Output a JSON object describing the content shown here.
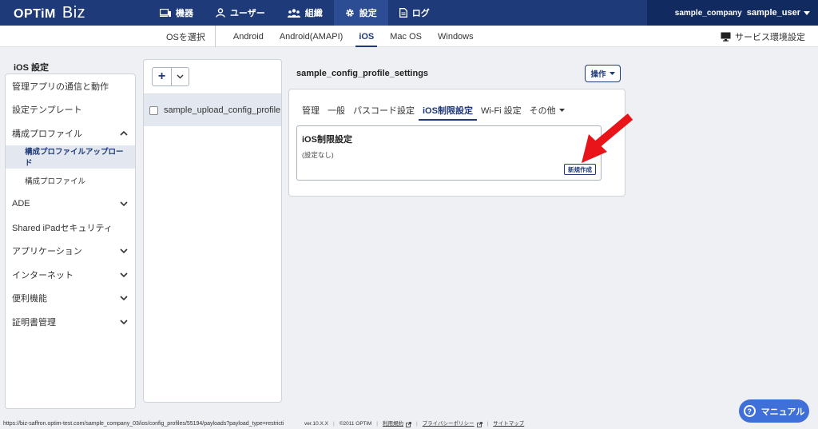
{
  "app": {
    "logo_brand": "OPTiM",
    "logo_product": "Biz"
  },
  "mainnav": {
    "devices": "機器",
    "users": "ユーザー",
    "org": "組織",
    "settings": "設定",
    "logs": "ログ"
  },
  "user": {
    "company": "sample_company",
    "name": "sample_user"
  },
  "subnav": {
    "os_select": "OSを選択",
    "tabs": [
      "Android",
      "Android(AMAPI)",
      "iOS",
      "Mac OS",
      "Windows"
    ],
    "active": "iOS",
    "service_settings": "サービス環境設定"
  },
  "sidebar": {
    "title": "iOS 設定",
    "items": [
      {
        "label": "管理アプリの通信と動作"
      },
      {
        "label": "設定テンプレート"
      },
      {
        "label": "構成プロファイル"
      },
      {
        "label": "構成プロファイルアップロード"
      },
      {
        "label": "構成プロファイル"
      },
      {
        "label": "ADE"
      },
      {
        "label": "Shared iPadセキュリティ"
      },
      {
        "label": "アプリケーション"
      },
      {
        "label": "インターネット"
      },
      {
        "label": "便利機能"
      },
      {
        "label": "証明書管理"
      }
    ]
  },
  "list": {
    "add_label": "+",
    "rows": [
      {
        "label": "sample_upload_config_profile"
      }
    ]
  },
  "detail": {
    "profile_name": "sample_config_profile_settings",
    "operations_label": "操作",
    "tabs": [
      "管理",
      "一般",
      "パスコード設定",
      "iOS制限設定",
      "Wi-Fi 設定",
      "その他"
    ],
    "active_tab": "iOS制限設定",
    "card_title": "iOS制限設定",
    "card_desc": "(設定なし)",
    "new_button": "新規作成"
  },
  "footer": {
    "status_url": "https://biz-saffron.optim-test.com/sample_company_03/ios/config_profiles/55194/payloads?payload_type=restricti",
    "version": "ver.10.X.X",
    "copyright": "©2011 OPTiM",
    "terms": "利用規約",
    "privacy": "プライバシーポリシー",
    "sitemap": "サイトマップ"
  },
  "manual": {
    "label": "マニュアル",
    "icon_char": "?"
  },
  "colors": {
    "nav_bg": "#1f3a78",
    "accent": "#1f3a78",
    "arrow": "#e8141a",
    "manual_bg": "#3f6fd8"
  }
}
